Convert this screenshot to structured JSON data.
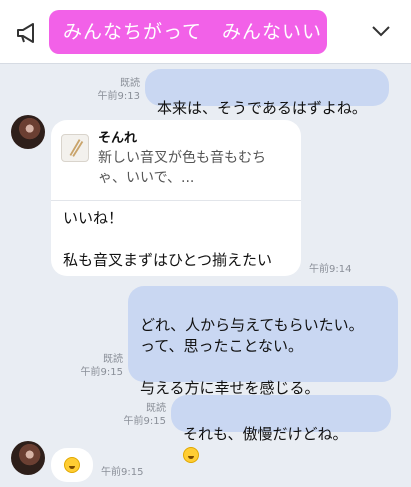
{
  "header": {
    "title": "みんなちがって　みんないい"
  },
  "messages": [
    {
      "read": "既読",
      "time": "午前9:13",
      "text": "本来は、そうであるはずよね。"
    },
    {
      "time": "午前9:14",
      "quote": {
        "name": "そんれ",
        "text": "新しい音叉が色も音もむちゃ、いいで、..."
      },
      "text": "いいね！\n\n私も音叉まずはひとつ揃えたい"
    },
    {
      "read": "既読",
      "time": "午前9:15",
      "text": "どれ、人から与えてもらいたい。\nって、思ったことない。\n\n与える方に幸せを感じる。"
    },
    {
      "read": "既読",
      "time": "午前9:15",
      "text": "それも、傲慢だけどね。"
    },
    {
      "time": "午前9:15"
    }
  ],
  "colors": {
    "pill": "#f261e8",
    "outgoing": "#c9d7f2",
    "background": "#e9edf3"
  },
  "icons": {
    "announce": "megaphone-icon",
    "chevron": "chevron-down-icon",
    "emoji": "laughing-emoji-icon"
  }
}
